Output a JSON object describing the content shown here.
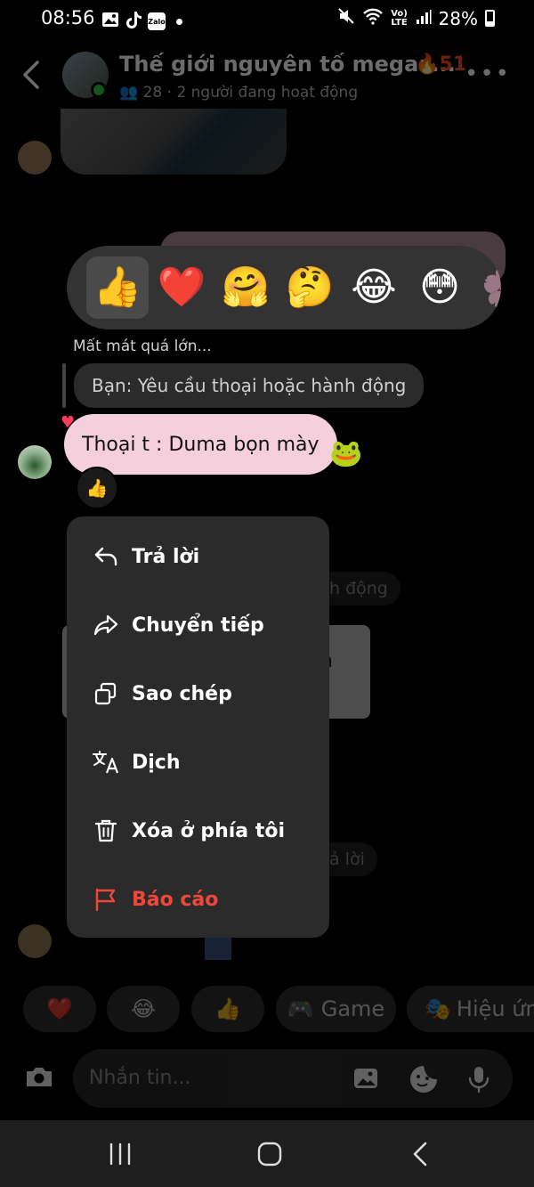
{
  "status_bar": {
    "time": "08:56",
    "apps": [
      "Zalo"
    ],
    "network": "Vo) LTE",
    "battery": "28%"
  },
  "header": {
    "title": "Thế giới nguyên tố megas...",
    "streak": "51",
    "members": "28",
    "active": "2 người đang hoạt động"
  },
  "reactions": [
    "👍",
    "❤️",
    "🤗",
    "🤔",
    "😂",
    "😳"
  ],
  "selected_reaction": 0,
  "reply_context": "Mất mát quá lớn...",
  "quoted_message": "Bạn: Yêu cầu thoại hoặc hành động",
  "message": {
    "text": "Thoại t : Duma bọn mày",
    "reaction": "👍"
  },
  "menu": {
    "reply": "Trả lời",
    "forward": "Chuyển tiếp",
    "copy": "Sao chép",
    "translate": "Dịch",
    "delete": "Xóa ở phía tôi",
    "report": "Báo cáo"
  },
  "background": {
    "partial_1": "h động",
    "partial_2": "ả lời",
    "partial_3": "n"
  },
  "quick_actions": {
    "heart": "❤️",
    "laugh": "😂",
    "like": "👍",
    "game": "Game",
    "effects": "Hiệu ứng"
  },
  "composer": {
    "placeholder": "Nhắn tin..."
  },
  "colors": {
    "menu_bg": "#2b2b2b",
    "danger": "#f0473a",
    "bubble_pink": "#f6cfdd"
  }
}
